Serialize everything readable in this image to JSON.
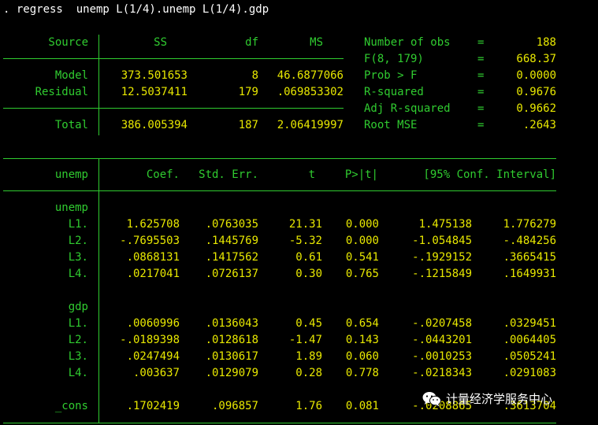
{
  "command": ". regress  unemp L(1/4).unemp L(1/4).gdp",
  "anova": {
    "headers": {
      "source": "Source",
      "ss": "SS",
      "df": "df",
      "ms": "MS"
    },
    "rows": [
      {
        "source": "Model",
        "ss": "373.501653",
        "df": "8",
        "ms": "46.6877066"
      },
      {
        "source": "Residual",
        "ss": "12.5037411",
        "df": "179",
        "ms": ".069853302"
      }
    ],
    "total": {
      "source": "Total",
      "ss": "386.005394",
      "df": "187",
      "ms": "2.06419997"
    }
  },
  "stats": [
    {
      "label": "Number of obs",
      "eq": "=",
      "value": "188"
    },
    {
      "label": "F(8, 179)",
      "eq": "=",
      "value": "668.37"
    },
    {
      "label": "Prob > F",
      "eq": "=",
      "value": "0.0000"
    },
    {
      "label": "R-squared",
      "eq": "=",
      "value": "0.9676"
    },
    {
      "label": "Adj R-squared",
      "eq": "=",
      "value": "0.9662"
    },
    {
      "label": "Root MSE",
      "eq": "=",
      "value": ".2643"
    }
  ],
  "coef_table": {
    "headers": {
      "var": "unemp",
      "coef": "Coef.",
      "se": "Std. Err.",
      "t": "t",
      "p": "P>|t|",
      "ci": "[95% Conf. Interval]"
    },
    "groups": [
      {
        "name": "unemp",
        "rows": [
          {
            "label": "L1.",
            "coef": "1.625708",
            "se": ".0763035",
            "t": "21.31",
            "p": "0.000",
            "lo": "1.475138",
            "hi": "1.776279"
          },
          {
            "label": "L2.",
            "coef": "-.7695503",
            "se": ".1445769",
            "t": "-5.32",
            "p": "0.000",
            "lo": "-1.054845",
            "hi": "-.484256"
          },
          {
            "label": "L3.",
            "coef": ".0868131",
            "se": ".1417562",
            "t": "0.61",
            "p": "0.541",
            "lo": "-.1929152",
            "hi": ".3665415"
          },
          {
            "label": "L4.",
            "coef": ".0217041",
            "se": ".0726137",
            "t": "0.30",
            "p": "0.765",
            "lo": "-.1215849",
            "hi": ".1649931"
          }
        ]
      },
      {
        "name": "gdp",
        "rows": [
          {
            "label": "L1.",
            "coef": ".0060996",
            "se": ".0136043",
            "t": "0.45",
            "p": "0.654",
            "lo": "-.0207458",
            "hi": ".0329451"
          },
          {
            "label": "L2.",
            "coef": "-.0189398",
            "se": ".0128618",
            "t": "-1.47",
            "p": "0.143",
            "lo": "-.0443201",
            "hi": ".0064405"
          },
          {
            "label": "L3.",
            "coef": ".0247494",
            "se": ".0130617",
            "t": "1.89",
            "p": "0.060",
            "lo": "-.0010253",
            "hi": ".0505241"
          },
          {
            "label": "L4.",
            "coef": ".003637",
            "se": ".0129079",
            "t": "0.28",
            "p": "0.778",
            "lo": "-.0218343",
            "hi": ".0291083"
          }
        ]
      }
    ],
    "cons": {
      "label": "_cons",
      "coef": ".1702419",
      "se": ".096857",
      "t": "1.76",
      "p": "0.081",
      "lo": "-.0208865",
      "hi": ".3613704"
    }
  },
  "watermark": {
    "text": "计量经济学服务中心",
    "icon": "wechat-icon"
  },
  "colors": {
    "background": "#000000",
    "text": "#ffffff",
    "label": "#30cc30",
    "value": "#e8e800"
  }
}
